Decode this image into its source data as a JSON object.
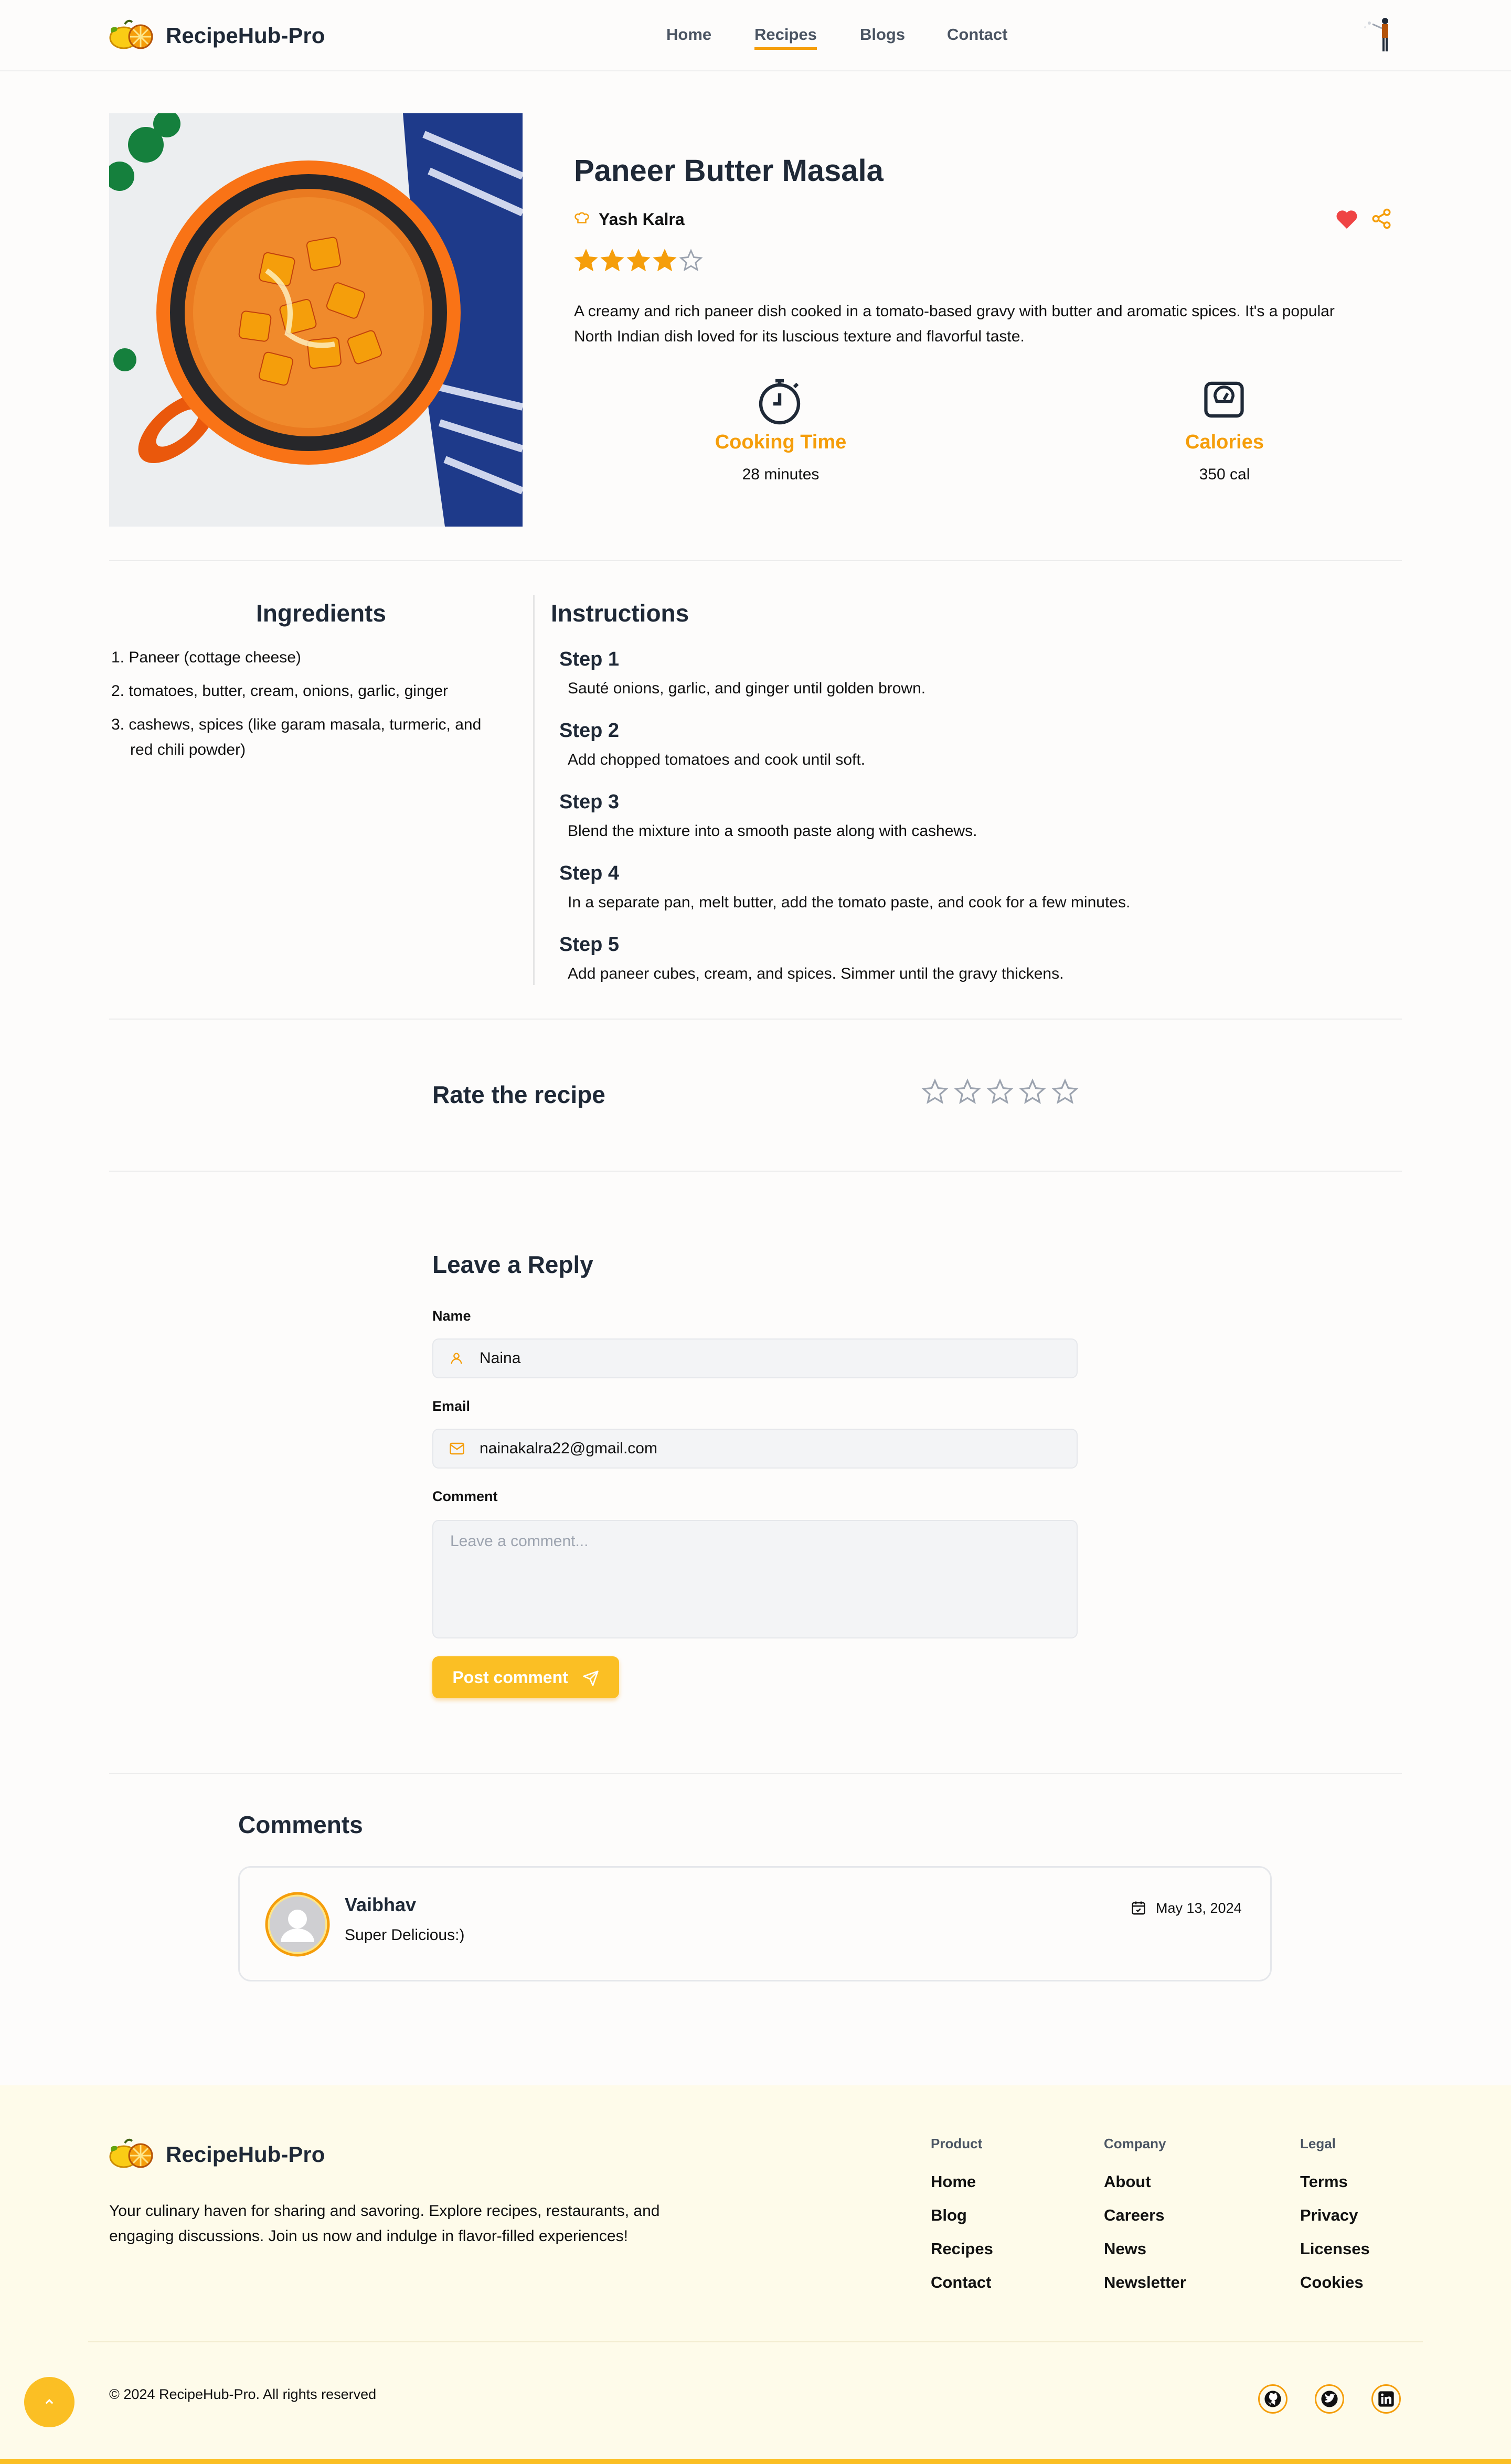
{
  "brand": {
    "name": "RecipeHub-Pro"
  },
  "nav": {
    "home": "Home",
    "recipes": "Recipes",
    "blogs": "Blogs",
    "contact": "Contact"
  },
  "recipe": {
    "title": "Paneer Butter Masala",
    "author": "Yash Kalra",
    "rating": 4,
    "rating_max": 5,
    "description": "A creamy and rich paneer dish cooked in a tomato-based gravy with butter and aromatic spices. It's a popular North Indian dish loved for its luscious texture and flavorful taste.",
    "cooking_time_label": "Cooking Time",
    "cooking_time_value": "28 minutes",
    "calories_label": "Calories",
    "calories_value": "350 cal"
  },
  "ingredients": {
    "heading": "Ingredients",
    "items": [
      "1. Paneer (cottage cheese)",
      "2. tomatoes, butter, cream, onions, garlic, ginger",
      "3. cashews, spices (like garam masala, turmeric, and",
      "red chili powder)"
    ]
  },
  "instructions": {
    "heading": "Instructions",
    "steps": [
      {
        "title": "Step 1",
        "text": "Sauté onions, garlic, and ginger until golden brown."
      },
      {
        "title": "Step 2",
        "text": "Add chopped tomatoes and cook until soft."
      },
      {
        "title": "Step 3",
        "text": "Blend the mixture into a smooth paste along with cashews."
      },
      {
        "title": "Step 4",
        "text": "In a separate pan, melt butter, add the tomato paste, and cook for a few minutes."
      },
      {
        "title": "Step 5",
        "text": "Add paneer cubes, cream, and spices. Simmer until the gravy thickens."
      }
    ]
  },
  "rate": {
    "label": "Rate the recipe",
    "value": 0,
    "max": 5
  },
  "reply": {
    "heading": "Leave a Reply",
    "name_label": "Name",
    "name_value": "Naina",
    "email_label": "Email",
    "email_value": "nainakalra22@gmail.com",
    "comment_label": "Comment",
    "comment_placeholder": "Leave a comment...",
    "submit_label": "Post comment"
  },
  "comments": {
    "heading": "Comments",
    "items": [
      {
        "author": "Vaibhav",
        "text": "Super Delicious:)",
        "date": "May 13, 2024"
      }
    ]
  },
  "footer": {
    "brand": "RecipeHub-Pro",
    "tagline_line1": "Your culinary haven for sharing and savoring. Explore recipes, restaurants, and",
    "tagline_line2": "engaging discussions. Join us now and indulge in flavor-filled experiences!",
    "product": {
      "heading": "Product",
      "links": [
        "Home",
        "Blog",
        "Recipes",
        "Contact"
      ]
    },
    "company": {
      "heading": "Company",
      "links": [
        "About",
        "Careers",
        "News",
        "Newsletter"
      ]
    },
    "legal": {
      "heading": "Legal",
      "links": [
        "Terms",
        "Privacy",
        "Licenses",
        "Cookies"
      ]
    },
    "copyright": "© 2024 RecipeHub-Pro. All rights reserved"
  },
  "colors": {
    "accent": "#f59e0b",
    "heart": "#ef4444",
    "footer_bg": "#fefbea"
  },
  "icons": [
    "lemon-logo-icon",
    "chef-hat-icon",
    "star-icon",
    "heart-icon",
    "share-icon",
    "stopwatch-icon",
    "scale-icon",
    "user-icon",
    "mail-icon",
    "send-icon",
    "calendar-icon",
    "github-icon",
    "twitter-icon",
    "linkedin-icon",
    "chevron-up-icon"
  ]
}
